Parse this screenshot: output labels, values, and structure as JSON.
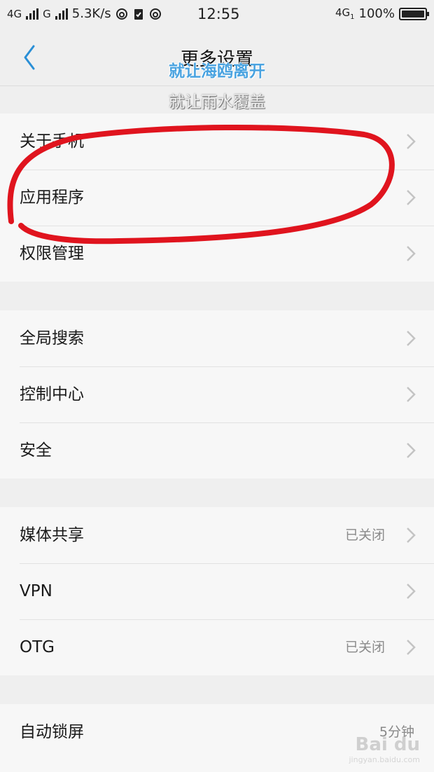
{
  "status_bar": {
    "network1": "4G",
    "network2": "G",
    "speed": "5.3K/s",
    "time": "12:55",
    "network_right": "4G",
    "sim_index": "1",
    "battery": "100%"
  },
  "header": {
    "title": "更多设置",
    "overlay_line1": "就让海鸥离开",
    "overlay_line2": "就让雨水覆盖"
  },
  "sections": [
    {
      "items": [
        {
          "label": "关于手机"
        },
        {
          "label": "应用程序"
        },
        {
          "label": "权限管理"
        }
      ]
    },
    {
      "items": [
        {
          "label": "全局搜索"
        },
        {
          "label": "控制中心"
        },
        {
          "label": "安全"
        }
      ]
    },
    {
      "items": [
        {
          "label": "媒体共享",
          "value": "已关闭"
        },
        {
          "label": "VPN"
        },
        {
          "label": "OTG",
          "value": "已关闭"
        }
      ]
    },
    {
      "items": [
        {
          "label": "自动锁屏",
          "value": "5分钟"
        }
      ]
    }
  ],
  "watermark": {
    "logo": "Bai du",
    "url": "jingyan.baidu.com"
  },
  "colors": {
    "accent": "#2a8fd6",
    "annotation": "#e0141e",
    "background": "#efefef",
    "row_bg": "#f7f7f7"
  }
}
